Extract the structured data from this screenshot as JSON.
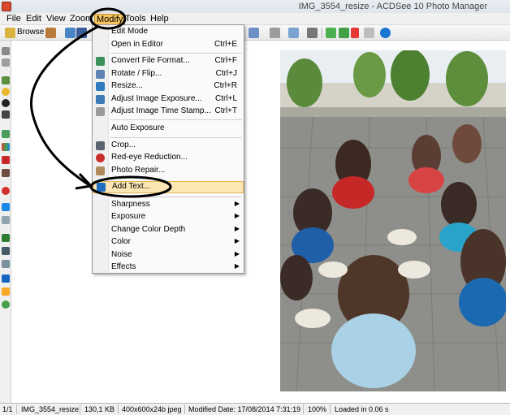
{
  "window": {
    "title": "IMG_3554_resize - ACDSee 10 Photo Manager"
  },
  "menubar": {
    "items": [
      {
        "label": "File"
      },
      {
        "label": "Edit"
      },
      {
        "label": "View"
      },
      {
        "label": "Zoom"
      },
      {
        "label": "Modify"
      },
      {
        "label": "Tools"
      },
      {
        "label": "Help"
      }
    ]
  },
  "toolbar": {
    "browse_label": "Browse"
  },
  "modify_menu": {
    "items": [
      {
        "label": "Edit Mode",
        "shortcut": ""
      },
      {
        "label": "Open in Editor",
        "shortcut": "Ctrl+E"
      },
      {
        "label": "Convert File Format...",
        "shortcut": "Ctrl+F"
      },
      {
        "label": "Rotate / Flip...",
        "shortcut": "Ctrl+J"
      },
      {
        "label": "Resize...",
        "shortcut": "Ctrl+R"
      },
      {
        "label": "Adjust Image Exposure...",
        "shortcut": "Ctrl+L"
      },
      {
        "label": "Adjust Image Time Stamp...",
        "shortcut": "Ctrl+T"
      },
      {
        "label": "Auto Exposure",
        "shortcut": ""
      },
      {
        "label": "Crop...",
        "shortcut": ""
      },
      {
        "label": "Red-eye Reduction...",
        "shortcut": ""
      },
      {
        "label": "Photo Repair...",
        "shortcut": ""
      },
      {
        "label": "Add Text...",
        "shortcut": ""
      },
      {
        "label": "Sharpness",
        "shortcut": ""
      },
      {
        "label": "Exposure",
        "shortcut": ""
      },
      {
        "label": "Change Color Depth",
        "shortcut": ""
      },
      {
        "label": "Color",
        "shortcut": ""
      },
      {
        "label": "Noise",
        "shortcut": ""
      },
      {
        "label": "Effects",
        "shortcut": ""
      }
    ],
    "highlighted": "Add Text..."
  },
  "statusbar": {
    "index": "1/1",
    "filename": "IMG_3554_resize",
    "filesize": "130,1 KB",
    "dimensions": "400x600x24b jpeg",
    "modified": "Modified Date: 17/08/2014 7:31:19",
    "zoom": "100%",
    "load_time": "Loaded in 0.06 s"
  },
  "colors": {
    "menu_highlight": "#fbe6b4",
    "active_menu": "#f7c660"
  }
}
